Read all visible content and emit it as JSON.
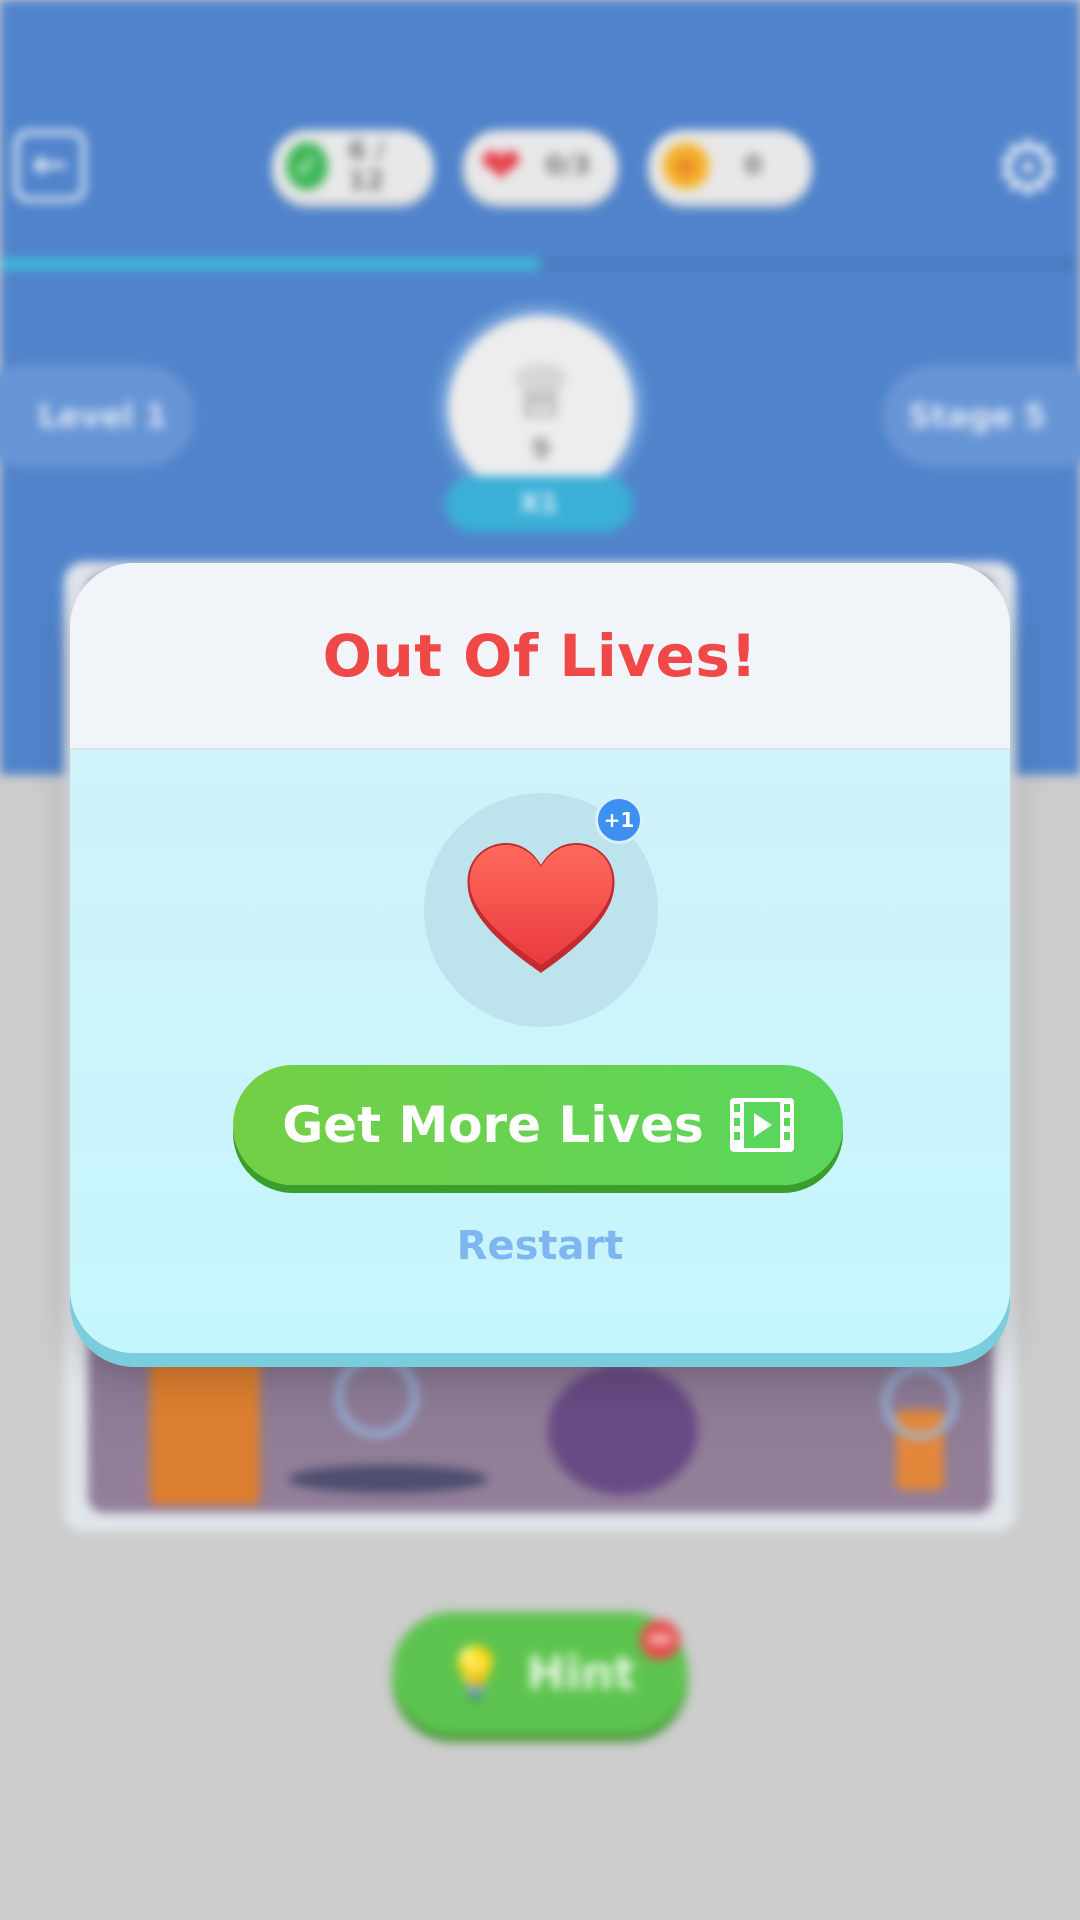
{
  "hud": {
    "progress_label": "6 / 12",
    "lives_label": "0/3",
    "coins_label": "0",
    "level_progress_fraction": 0.5
  },
  "level_row": {
    "level_label": "Level 1",
    "stage_label": "Stage 5",
    "crown_count": "9",
    "multiplier_label": "X1"
  },
  "hint": {
    "label": "Hint",
    "badge": "AD"
  },
  "modal": {
    "title": "Out Of Lives!",
    "reward_badge": "+1",
    "get_more_lives_label": "Get More Lives",
    "restart_label": "Restart"
  },
  "colors": {
    "title_red": "#f04747",
    "button_green": "#5ad65c",
    "restart_blue": "#7fb6f2",
    "badge_blue": "#3d8ff0",
    "top_band_blue": "#4279c7"
  },
  "icons": {
    "back": "arrow-left-icon",
    "check": "check-circle-icon",
    "heart": "heart-icon",
    "coin": "coin-icon",
    "settings": "gear-icon",
    "crown": "crown-icon",
    "hint": "lightbulb-icon",
    "video": "video-ad-icon"
  }
}
